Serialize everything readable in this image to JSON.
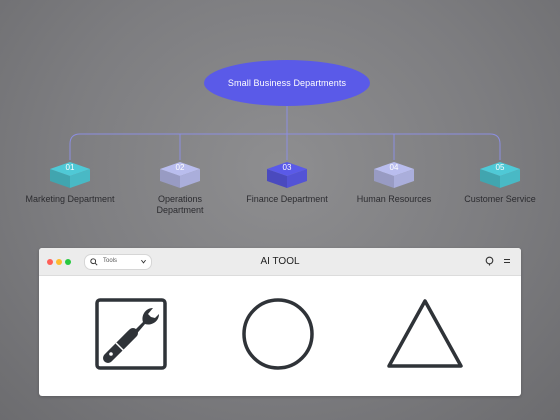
{
  "org_chart": {
    "root": {
      "label": "Small Business Departments",
      "color": "#5a5ae8"
    },
    "departments": [
      {
        "number": "01",
        "label_lines": [
          "Marketing Department"
        ],
        "color": "#4fc9d6"
      },
      {
        "number": "02",
        "label_lines": [
          "Operations",
          "Department"
        ],
        "color": "#b9bdee"
      },
      {
        "number": "03",
        "label_lines": [
          "Finance Department"
        ],
        "color": "#5a5ae8"
      },
      {
        "number": "04",
        "label_lines": [
          "Human Resources"
        ],
        "color": "#b9bdee"
      },
      {
        "number": "05",
        "label_lines": [
          "Customer Service"
        ],
        "color": "#4fc9d6"
      }
    ],
    "connector_color": "#8c8ee0"
  },
  "window": {
    "title": "AI TOOL",
    "traffic_lights": [
      "#ff5f57",
      "#febc2e",
      "#28c840"
    ],
    "search": {
      "text": "Tools",
      "icon": "search-icon",
      "dropdown_icon": "chevron-down-icon"
    },
    "toolbar_icons": [
      "search-icon",
      "menu-icon"
    ],
    "tools": [
      {
        "icon": "wrench-screwdriver-icon"
      },
      {
        "icon": "circle-icon"
      },
      {
        "icon": "triangle-icon"
      }
    ]
  }
}
